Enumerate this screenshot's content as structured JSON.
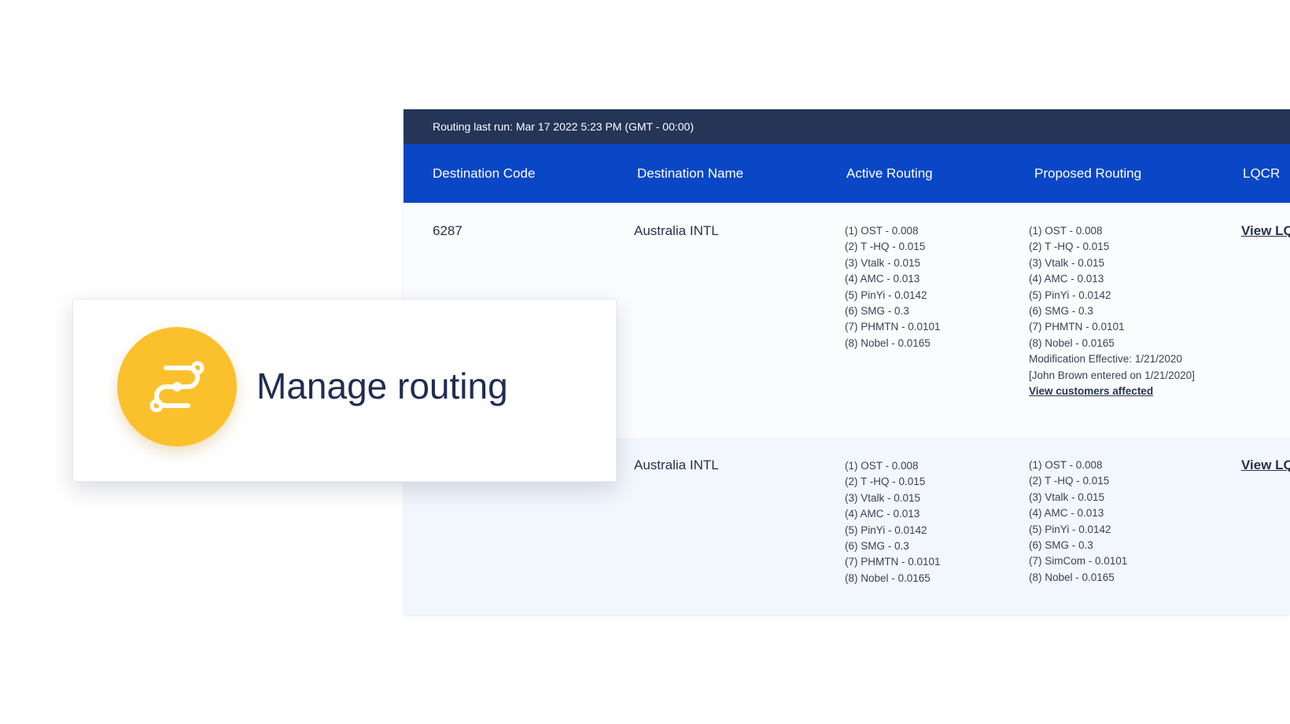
{
  "status_bar": {
    "text": "Routing last run: Mar 17 2022 5:23 PM (GMT - 00:00)"
  },
  "columns": [
    "Destination Code",
    "Destination Name",
    "Active Routing",
    "Proposed Routing",
    "LQCR"
  ],
  "rows": [
    {
      "code": "6287",
      "name": "Australia INTL",
      "active": [
        "(1) OST - 0.008",
        "(2) T -HQ - 0.015",
        "(3) Vtalk - 0.015",
        "(4) AMC - 0.013",
        "(5) PinYi - 0.0142",
        "(6) SMG - 0.3",
        "(7) PHMTN - 0.0101",
        "(8) Nobel - 0.0165"
      ],
      "proposed": [
        "(1) OST - 0.008",
        "(2) T -HQ - 0.015",
        "(3) Vtalk - 0.015",
        "(4) AMC - 0.013",
        "(5) PinYi - 0.0142",
        "(6) SMG - 0.3",
        "(7) PHMTN - 0.0101",
        "(8) Nobel - 0.0165",
        "Modification Effective: 1/21/2020",
        "[John Brown entered on 1/21/2020]"
      ],
      "proposed_link": "View customers affected",
      "lqcr_link": "View LQ"
    },
    {
      "code": "",
      "name": "Australia INTL",
      "active": [
        "(1) OST - 0.008",
        "(2) T -HQ - 0.015",
        "(3) Vtalk - 0.015",
        "(4) AMC - 0.013",
        "(5) PinYi - 0.0142",
        "(6) SMG - 0.3",
        "(7) PHMTN - 0.0101",
        "(8) Nobel - 0.0165"
      ],
      "proposed": [
        "(1) OST - 0.008",
        "(2) T -HQ - 0.015",
        "(3) Vtalk - 0.015",
        "(4) AMC - 0.013",
        "(5) PinYi - 0.0142",
        "(6) SMG - 0.3",
        "(7) SimCom - 0.0101",
        "(8) Nobel - 0.0165"
      ],
      "lqcr_link": "View LQ"
    }
  ],
  "card": {
    "title": "Manage routing",
    "icon": "routing-icon"
  },
  "colors": {
    "header_bg": "#0a47c6",
    "status_bg": "#243558",
    "badge": "#fbc12d",
    "row_alt": "#f2f6fd"
  }
}
